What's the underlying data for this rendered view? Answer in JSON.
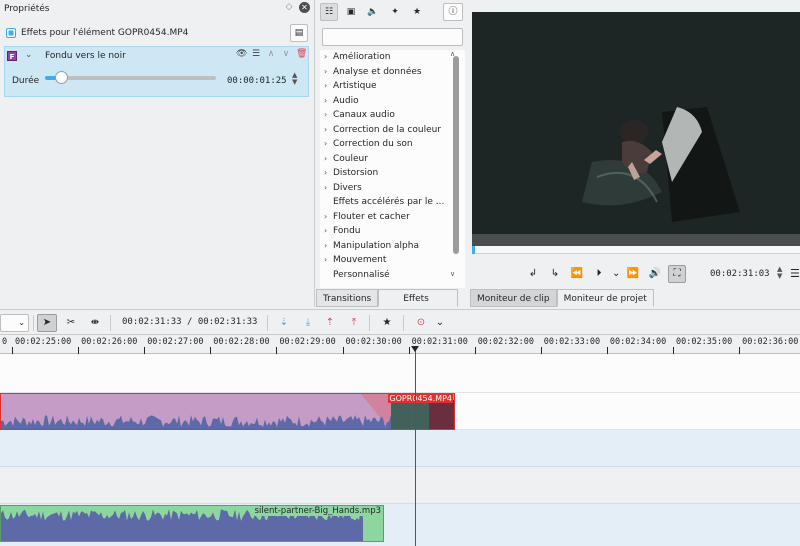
{
  "properties": {
    "title": "Propriétés",
    "effects_for": "Effets pour l'élément GOPR0454.MP4",
    "effect": {
      "icon_letter": "F",
      "name": "Fondu vers le noir",
      "param_label": "Durée",
      "param_value": "00:00:01:25",
      "param_fraction": 0.1
    }
  },
  "effects_list": {
    "items": [
      {
        "arrow": "›",
        "label": "Amélioration"
      },
      {
        "arrow": "›",
        "label": "Analyse et données"
      },
      {
        "arrow": "›",
        "label": "Artistique"
      },
      {
        "arrow": "›",
        "label": "Audio"
      },
      {
        "arrow": "›",
        "label": "Canaux audio"
      },
      {
        "arrow": "›",
        "label": "Correction de la couleur"
      },
      {
        "arrow": "›",
        "label": "Correction du son"
      },
      {
        "arrow": "›",
        "label": "Couleur"
      },
      {
        "arrow": "›",
        "label": "Distorsion"
      },
      {
        "arrow": "›",
        "label": "Divers"
      },
      {
        "arrow": "",
        "label": "Effets accélérés par le ..."
      },
      {
        "arrow": "›",
        "label": "Flouter et cacher"
      },
      {
        "arrow": "›",
        "label": "Fondu"
      },
      {
        "arrow": "›",
        "label": "Manipulation alpha"
      },
      {
        "arrow": "›",
        "label": "Mouvement"
      },
      {
        "arrow": "",
        "label": "Personnalisé"
      }
    ],
    "tabs": [
      "Transitions",
      "Effets"
    ]
  },
  "monitor": {
    "timecode": "00:02:31:03",
    "tabs": [
      "Moniteur de clip",
      "Moniteur de projet"
    ]
  },
  "timeline": {
    "position": "00:02:31:33 / 00:02:31:33",
    "ruler_labels": [
      "00:02:25:00",
      "00:02:26:00",
      "00:02:27:00",
      "00:02:28:00",
      "00:02:29:00",
      "00:02:30:00",
      "00:02:31:00",
      "00:02:32:00",
      "00:02:33:00",
      "00:02:34:00",
      "00:02:35:00",
      "00:02:36:00"
    ],
    "ruler_first": "0",
    "video_clip": "GOPR0454.MP4",
    "audio_clip": "silent-partner-Big_Hands.mp3"
  },
  "colors": {
    "accent": "#3daee9",
    "video_clip": "#c59cc6",
    "audio_clip": "#8ed6a0",
    "waveform": "#5e6aa8",
    "clip_selected_border": "#e03030"
  }
}
